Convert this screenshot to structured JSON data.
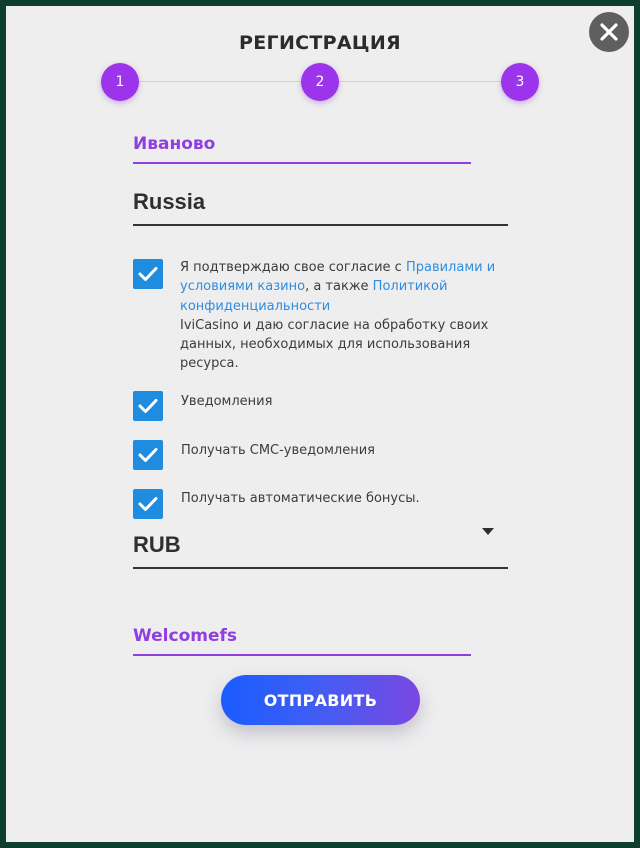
{
  "modal": {
    "title": "РЕГИСТРАЦИЯ"
  },
  "steps": [
    "1",
    "2",
    "3"
  ],
  "form": {
    "city_value": "Иваново",
    "country_value": "Russia",
    "currency_value": "RUB",
    "promo_value": "Welcomefs"
  },
  "terms": {
    "part1": "Я подтверждаю свое согласие с ",
    "link1": "Правилами и условиями казино",
    "part2": ", а также ",
    "link2": "Политикой конфиденциальности",
    "part3": "IviCasino и даю согласие на обработку своих данных, необходимых для использования ресурса."
  },
  "checkboxes": {
    "notifications_label": "Уведомления",
    "sms_label": "Получать СМС-уведомления",
    "bonuses_label": "Получать автоматические бонусы."
  },
  "submit": {
    "label": "ОТПРАВИТЬ"
  },
  "icons": {
    "close": "close-icon",
    "check": "checkmark-icon",
    "dropdown": "caret-down-icon"
  },
  "colors": {
    "accent_purple": "#9b34eb",
    "checkbox_blue": "#1f8ce0",
    "link_blue": "#2d8de0",
    "button_gradient_start": "#1a5cff",
    "button_gradient_end": "#7a48e0",
    "modal_background": "#efeeef"
  }
}
